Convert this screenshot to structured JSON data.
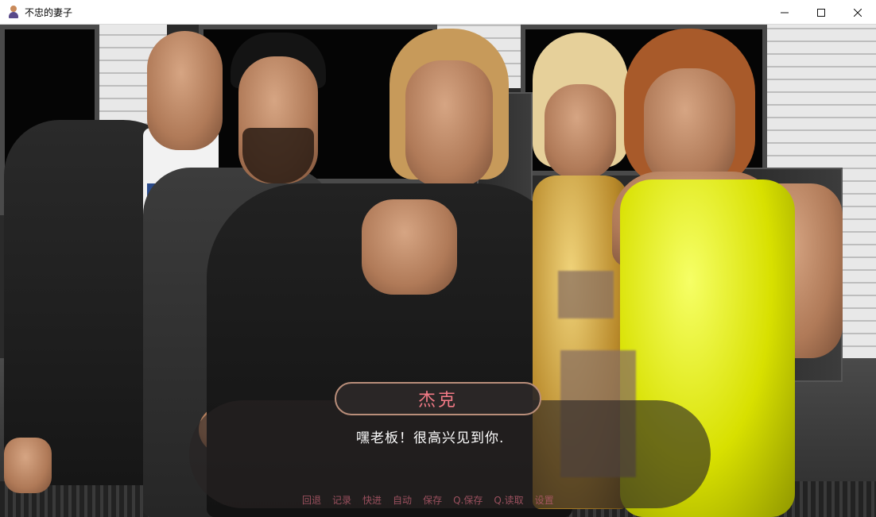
{
  "window": {
    "title": "不忠的妻子",
    "controls": {
      "minimize": "minimize",
      "maximize": "maximize",
      "close": "close"
    }
  },
  "dialogue": {
    "speaker": "杰克",
    "text": "嘿老板！很高兴见到你."
  },
  "quick_menu": {
    "items": [
      {
        "label": "回退"
      },
      {
        "label": "记录"
      },
      {
        "label": "快进"
      },
      {
        "label": "自动"
      },
      {
        "label": "保存"
      },
      {
        "label": "Q.保存"
      },
      {
        "label": "Q.读取"
      },
      {
        "label": "设置"
      }
    ]
  },
  "colors": {
    "speaker_name": "#f27a86",
    "dialog_text": "#ffffff",
    "name_plate_border": "#b98e7a",
    "quick_menu_text": "#b15a6a"
  }
}
